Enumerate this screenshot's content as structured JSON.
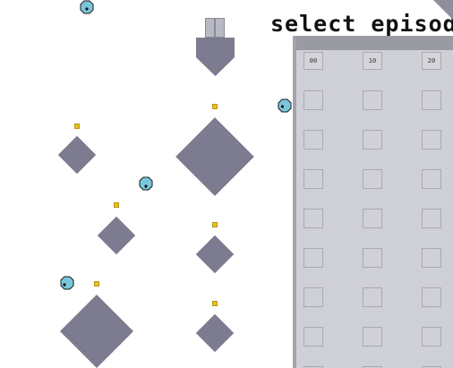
{
  "title": "select episod",
  "episode_columns": [
    "00",
    "10",
    "20"
  ],
  "slot_rows": 8,
  "colors": {
    "diamond": "#7c7b8f",
    "coin": "#e8c21c",
    "blob": "#79c7dc",
    "panel": "#cfcfd6"
  },
  "icons": {
    "blob": "blue-blob-icon",
    "coin": "gold-coin-icon",
    "chute": "spawner-chute-icon"
  }
}
